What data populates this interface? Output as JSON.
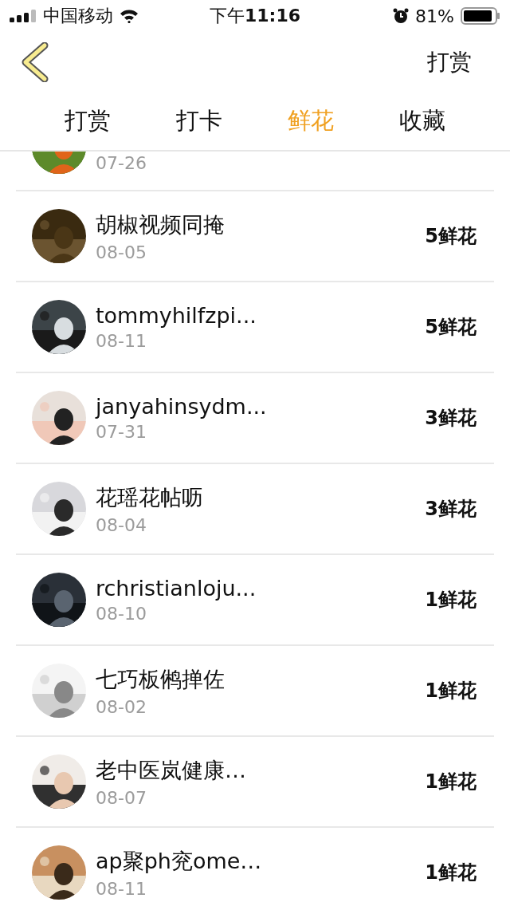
{
  "status_bar": {
    "carrier": "中国移动",
    "time": "下午**11:16**",
    "battery": "81%"
  },
  "nav": {
    "action": "打赏"
  },
  "tabs": [
    {
      "label": "打赏",
      "selected": false
    },
    {
      "label": "打卡",
      "selected": false
    },
    {
      "label": "鲜花",
      "selected": true
    },
    {
      "label": "收藏",
      "selected": false
    }
  ],
  "partial_row": {
    "date": "07-26"
  },
  "rows": [
    {
      "name": "胡椒视频同掩",
      "date": "08-05",
      "count": "5鲜花"
    },
    {
      "name": "tommyhilfzpi...",
      "date": "08-11",
      "count": "5鲜花"
    },
    {
      "name": "janyahinsydm...",
      "date": "07-31",
      "count": "3鲜花"
    },
    {
      "name": "花瑶花帖呖",
      "date": "08-04",
      "count": "3鲜花"
    },
    {
      "name": "rchristianloju...",
      "date": "08-10",
      "count": "1鲜花"
    },
    {
      "name": "七巧板鸺掸佐",
      "date": "08-02",
      "count": "1鲜花"
    },
    {
      "name": "老中医岚健康…",
      "date": "08-07",
      "count": "1鲜花"
    },
    {
      "name": "ap聚ph兖ome…",
      "date": "08-11",
      "count": "1鲜花"
    }
  ]
}
